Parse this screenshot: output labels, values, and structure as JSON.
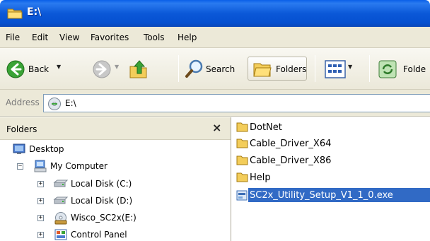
{
  "window": {
    "title": "E:\\"
  },
  "menu": [
    "File",
    "Edit",
    "View",
    "Favorites",
    "Tools",
    "Help"
  ],
  "toolbar": {
    "back_label": "Back",
    "search_label": "Search",
    "folders_label": "Folders",
    "folder_options_label": "Folde"
  },
  "address": {
    "label": "Address",
    "value": "E:\\"
  },
  "folders_pane": {
    "title": "Folders",
    "tree": [
      {
        "label": "Desktop",
        "icon": "desktop-icon"
      },
      {
        "label": "My Computer",
        "icon": "my-computer-icon",
        "expander": "−"
      },
      {
        "label": "Local Disk (C:)",
        "icon": "hard-disk-icon",
        "expander": "+"
      },
      {
        "label": "Local Disk (D:)",
        "icon": "hard-disk-icon",
        "expander": "+"
      },
      {
        "label": "Wisco_SC2x(E:)",
        "icon": "cd-drive-icon",
        "expander": "+"
      },
      {
        "label": "Control Panel",
        "icon": "control-panel-icon",
        "expander": "+"
      }
    ]
  },
  "files": [
    {
      "name": "DotNet",
      "type": "folder"
    },
    {
      "name": "Cable_Driver_X64",
      "type": "folder"
    },
    {
      "name": "Cable_Driver_X86",
      "type": "folder"
    },
    {
      "name": "Help",
      "type": "folder"
    },
    {
      "name": "SC2x_Utility_Setup_V1_1_0.exe",
      "type": "exe",
      "selected": true
    }
  ],
  "colors": {
    "titlebar": "#0b58d8",
    "selection": "#316ac5",
    "chrome": "#ece9d8"
  }
}
